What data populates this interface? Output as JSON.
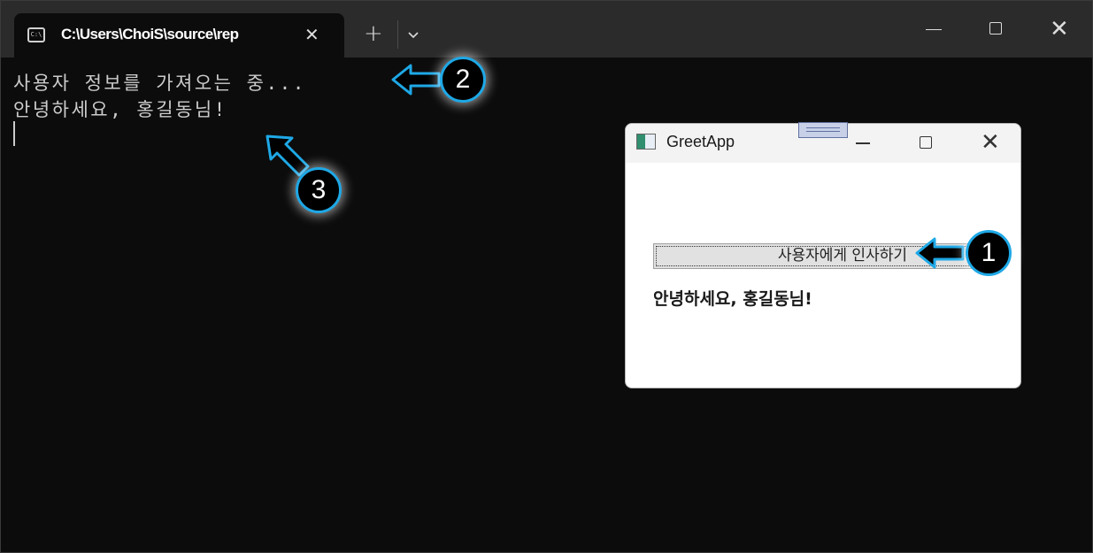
{
  "terminal": {
    "tab_title": "C:\\Users\\ChoiS\\source\\rep",
    "tab_close_glyph": "✕",
    "new_tab_glyph": "+",
    "dropdown_glyph": "⌄",
    "close_glyph": "✕",
    "output_lines": [
      "사용자 정보를 가져오는 중...",
      "안녕하세요, 홍길동님!"
    ]
  },
  "dialog": {
    "title": "GreetApp",
    "close_glyph": "✕",
    "button_label": "사용자에게 인사하기",
    "greeting": "안녕하세요, 홍길동님!"
  },
  "callouts": [
    "1",
    "2",
    "3"
  ],
  "colors": {
    "terminal_bg": "#0c0c0c",
    "titlebar_bg": "#2b2b2b",
    "callout_border": "#1ea8e6"
  }
}
